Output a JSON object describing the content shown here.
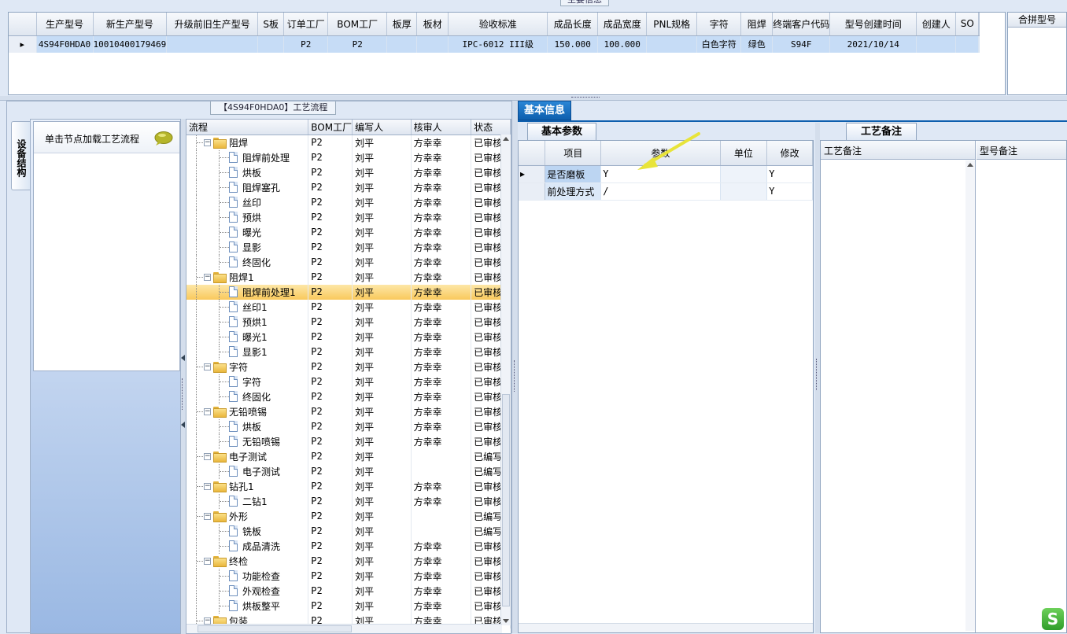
{
  "main_info": {
    "legend": "主要信息",
    "columns": [
      "生产型号",
      "新生产型号",
      "升级前旧生产型号",
      "S板",
      "订单工厂",
      "BOM工厂",
      "板厚",
      "板材",
      "验收标准",
      "成品长度",
      "成品宽度",
      "PNL规格",
      "字符",
      "阻焊",
      "终端客户代码",
      "型号创建时间",
      "创建人",
      "SO"
    ],
    "rows": [
      [
        "4S94F0HDA0",
        "10010400179469",
        "",
        "",
        "P2",
        "P2",
        "",
        "",
        "IPC-6012 III级",
        "150.000",
        "100.000",
        "",
        "白色字符",
        "绿色",
        "S94F",
        "2021/10/14",
        "",
        ""
      ]
    ],
    "row_marker": "▸",
    "merge_header": "合拼型号"
  },
  "process_panel": {
    "legend": "【4S94F0HDA0】工艺流程",
    "vertical_tab": "设备结构",
    "equip_hint": "单击节点加载工艺流程",
    "columns": [
      "流程",
      "BOM工厂",
      "编写人",
      "核审人",
      "状态"
    ],
    "rows": [
      {
        "level": 0,
        "label": "阻焊",
        "bom": "P2",
        "writer": "刘平",
        "reviewer": "方幸幸",
        "status": "已审核"
      },
      {
        "level": 1,
        "label": "阻焊前处理",
        "bom": "P2",
        "writer": "刘平",
        "reviewer": "方幸幸",
        "status": "已审核"
      },
      {
        "level": 1,
        "label": "烘板",
        "bom": "P2",
        "writer": "刘平",
        "reviewer": "方幸幸",
        "status": "已审核"
      },
      {
        "level": 1,
        "label": "阻焊塞孔",
        "bom": "P2",
        "writer": "刘平",
        "reviewer": "方幸幸",
        "status": "已审核"
      },
      {
        "level": 1,
        "label": "丝印",
        "bom": "P2",
        "writer": "刘平",
        "reviewer": "方幸幸",
        "status": "已审核"
      },
      {
        "level": 1,
        "label": "预烘",
        "bom": "P2",
        "writer": "刘平",
        "reviewer": "方幸幸",
        "status": "已审核"
      },
      {
        "level": 1,
        "label": "曝光",
        "bom": "P2",
        "writer": "刘平",
        "reviewer": "方幸幸",
        "status": "已审核"
      },
      {
        "level": 1,
        "label": "显影",
        "bom": "P2",
        "writer": "刘平",
        "reviewer": "方幸幸",
        "status": "已审核"
      },
      {
        "level": 1,
        "label": "终固化",
        "bom": "P2",
        "writer": "刘平",
        "reviewer": "方幸幸",
        "status": "已审核"
      },
      {
        "level": 0,
        "label": "阻焊1",
        "bom": "P2",
        "writer": "刘平",
        "reviewer": "方幸幸",
        "status": "已审核"
      },
      {
        "level": 1,
        "label": "阻焊前处理1",
        "bom": "P2",
        "writer": "刘平",
        "reviewer": "方幸幸",
        "status": "已审核",
        "selected": true
      },
      {
        "level": 1,
        "label": "丝印1",
        "bom": "P2",
        "writer": "刘平",
        "reviewer": "方幸幸",
        "status": "已审核"
      },
      {
        "level": 1,
        "label": "预烘1",
        "bom": "P2",
        "writer": "刘平",
        "reviewer": "方幸幸",
        "status": "已审核"
      },
      {
        "level": 1,
        "label": "曝光1",
        "bom": "P2",
        "writer": "刘平",
        "reviewer": "方幸幸",
        "status": "已审核"
      },
      {
        "level": 1,
        "label": "显影1",
        "bom": "P2",
        "writer": "刘平",
        "reviewer": "方幸幸",
        "status": "已审核"
      },
      {
        "level": 0,
        "label": "字符",
        "bom": "P2",
        "writer": "刘平",
        "reviewer": "方幸幸",
        "status": "已审核"
      },
      {
        "level": 1,
        "label": "字符",
        "bom": "P2",
        "writer": "刘平",
        "reviewer": "方幸幸",
        "status": "已审核"
      },
      {
        "level": 1,
        "label": "终固化",
        "bom": "P2",
        "writer": "刘平",
        "reviewer": "方幸幸",
        "status": "已审核"
      },
      {
        "level": 0,
        "label": "无铅喷锡",
        "bom": "P2",
        "writer": "刘平",
        "reviewer": "方幸幸",
        "status": "已审核"
      },
      {
        "level": 1,
        "label": "烘板",
        "bom": "P2",
        "writer": "刘平",
        "reviewer": "方幸幸",
        "status": "已审核"
      },
      {
        "level": 1,
        "label": "无铅喷锡",
        "bom": "P2",
        "writer": "刘平",
        "reviewer": "方幸幸",
        "status": "已审核"
      },
      {
        "level": 0,
        "label": "电子测试",
        "bom": "P2",
        "writer": "刘平",
        "reviewer": "",
        "status": "已编写"
      },
      {
        "level": 1,
        "label": "电子测试",
        "bom": "P2",
        "writer": "刘平",
        "reviewer": "",
        "status": "已编写"
      },
      {
        "level": 0,
        "label": "钻孔1",
        "bom": "P2",
        "writer": "刘平",
        "reviewer": "方幸幸",
        "status": "已审核"
      },
      {
        "level": 1,
        "label": "二钻1",
        "bom": "P2",
        "writer": "刘平",
        "reviewer": "方幸幸",
        "status": "已审核"
      },
      {
        "level": 0,
        "label": "外形",
        "bom": "P2",
        "writer": "刘平",
        "reviewer": "",
        "status": "已编写"
      },
      {
        "level": 1,
        "label": "铣板",
        "bom": "P2",
        "writer": "刘平",
        "reviewer": "",
        "status": "已编写"
      },
      {
        "level": 1,
        "label": "成品清洗",
        "bom": "P2",
        "writer": "刘平",
        "reviewer": "方幸幸",
        "status": "已审核"
      },
      {
        "level": 0,
        "label": "终检",
        "bom": "P2",
        "writer": "刘平",
        "reviewer": "方幸幸",
        "status": "已审核"
      },
      {
        "level": 1,
        "label": "功能检查",
        "bom": "P2",
        "writer": "刘平",
        "reviewer": "方幸幸",
        "status": "已审核"
      },
      {
        "level": 1,
        "label": "外观检查",
        "bom": "P2",
        "writer": "刘平",
        "reviewer": "方幸幸",
        "status": "已审核"
      },
      {
        "level": 1,
        "label": "烘板整平",
        "bom": "P2",
        "writer": "刘平",
        "reviewer": "方幸幸",
        "status": "已审核"
      },
      {
        "level": 0,
        "label": "包装",
        "bom": "P2",
        "writer": "刘平",
        "reviewer": "方幸幸",
        "status": "已审核"
      }
    ]
  },
  "basic_info": {
    "tab": "基本信息",
    "params_tab": "基本参数",
    "columns": [
      "项目",
      "参数",
      "单位",
      "修改"
    ],
    "rows": [
      {
        "item": "是否磨板",
        "param": "Y",
        "unit": "",
        "modify": "Y",
        "current": true
      },
      {
        "item": "前处理方式",
        "param": "/",
        "unit": "",
        "modify": "Y"
      }
    ],
    "notes_tab": "工艺备注",
    "process_note_header": "工艺备注",
    "model_note_header": "型号备注"
  },
  "colors": {
    "selected_row": "#f9c95c",
    "info_tab": "#0e5fae",
    "arrow": "#e8e43a"
  },
  "logo_text": "S"
}
